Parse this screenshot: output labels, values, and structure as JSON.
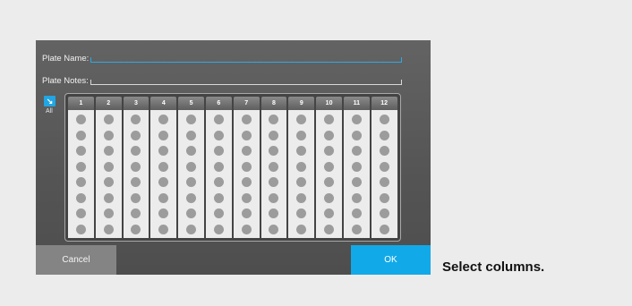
{
  "dialog": {
    "plate_name_label": "Plate Name:",
    "plate_notes_label": "Plate Notes:",
    "all_label": "All",
    "columns": [
      "1",
      "2",
      "3",
      "4",
      "5",
      "6",
      "7",
      "8",
      "9",
      "10",
      "11",
      "12"
    ],
    "rows_per_column": 8,
    "cancel_label": "Cancel",
    "ok_label": "OK"
  },
  "caption": "Select columns.",
  "colors": {
    "accent": "#12a9e8",
    "panel": "#5a5a5a",
    "well": "#9c9c9c"
  },
  "icons": {
    "all_button": "select-all-arrow-icon"
  }
}
